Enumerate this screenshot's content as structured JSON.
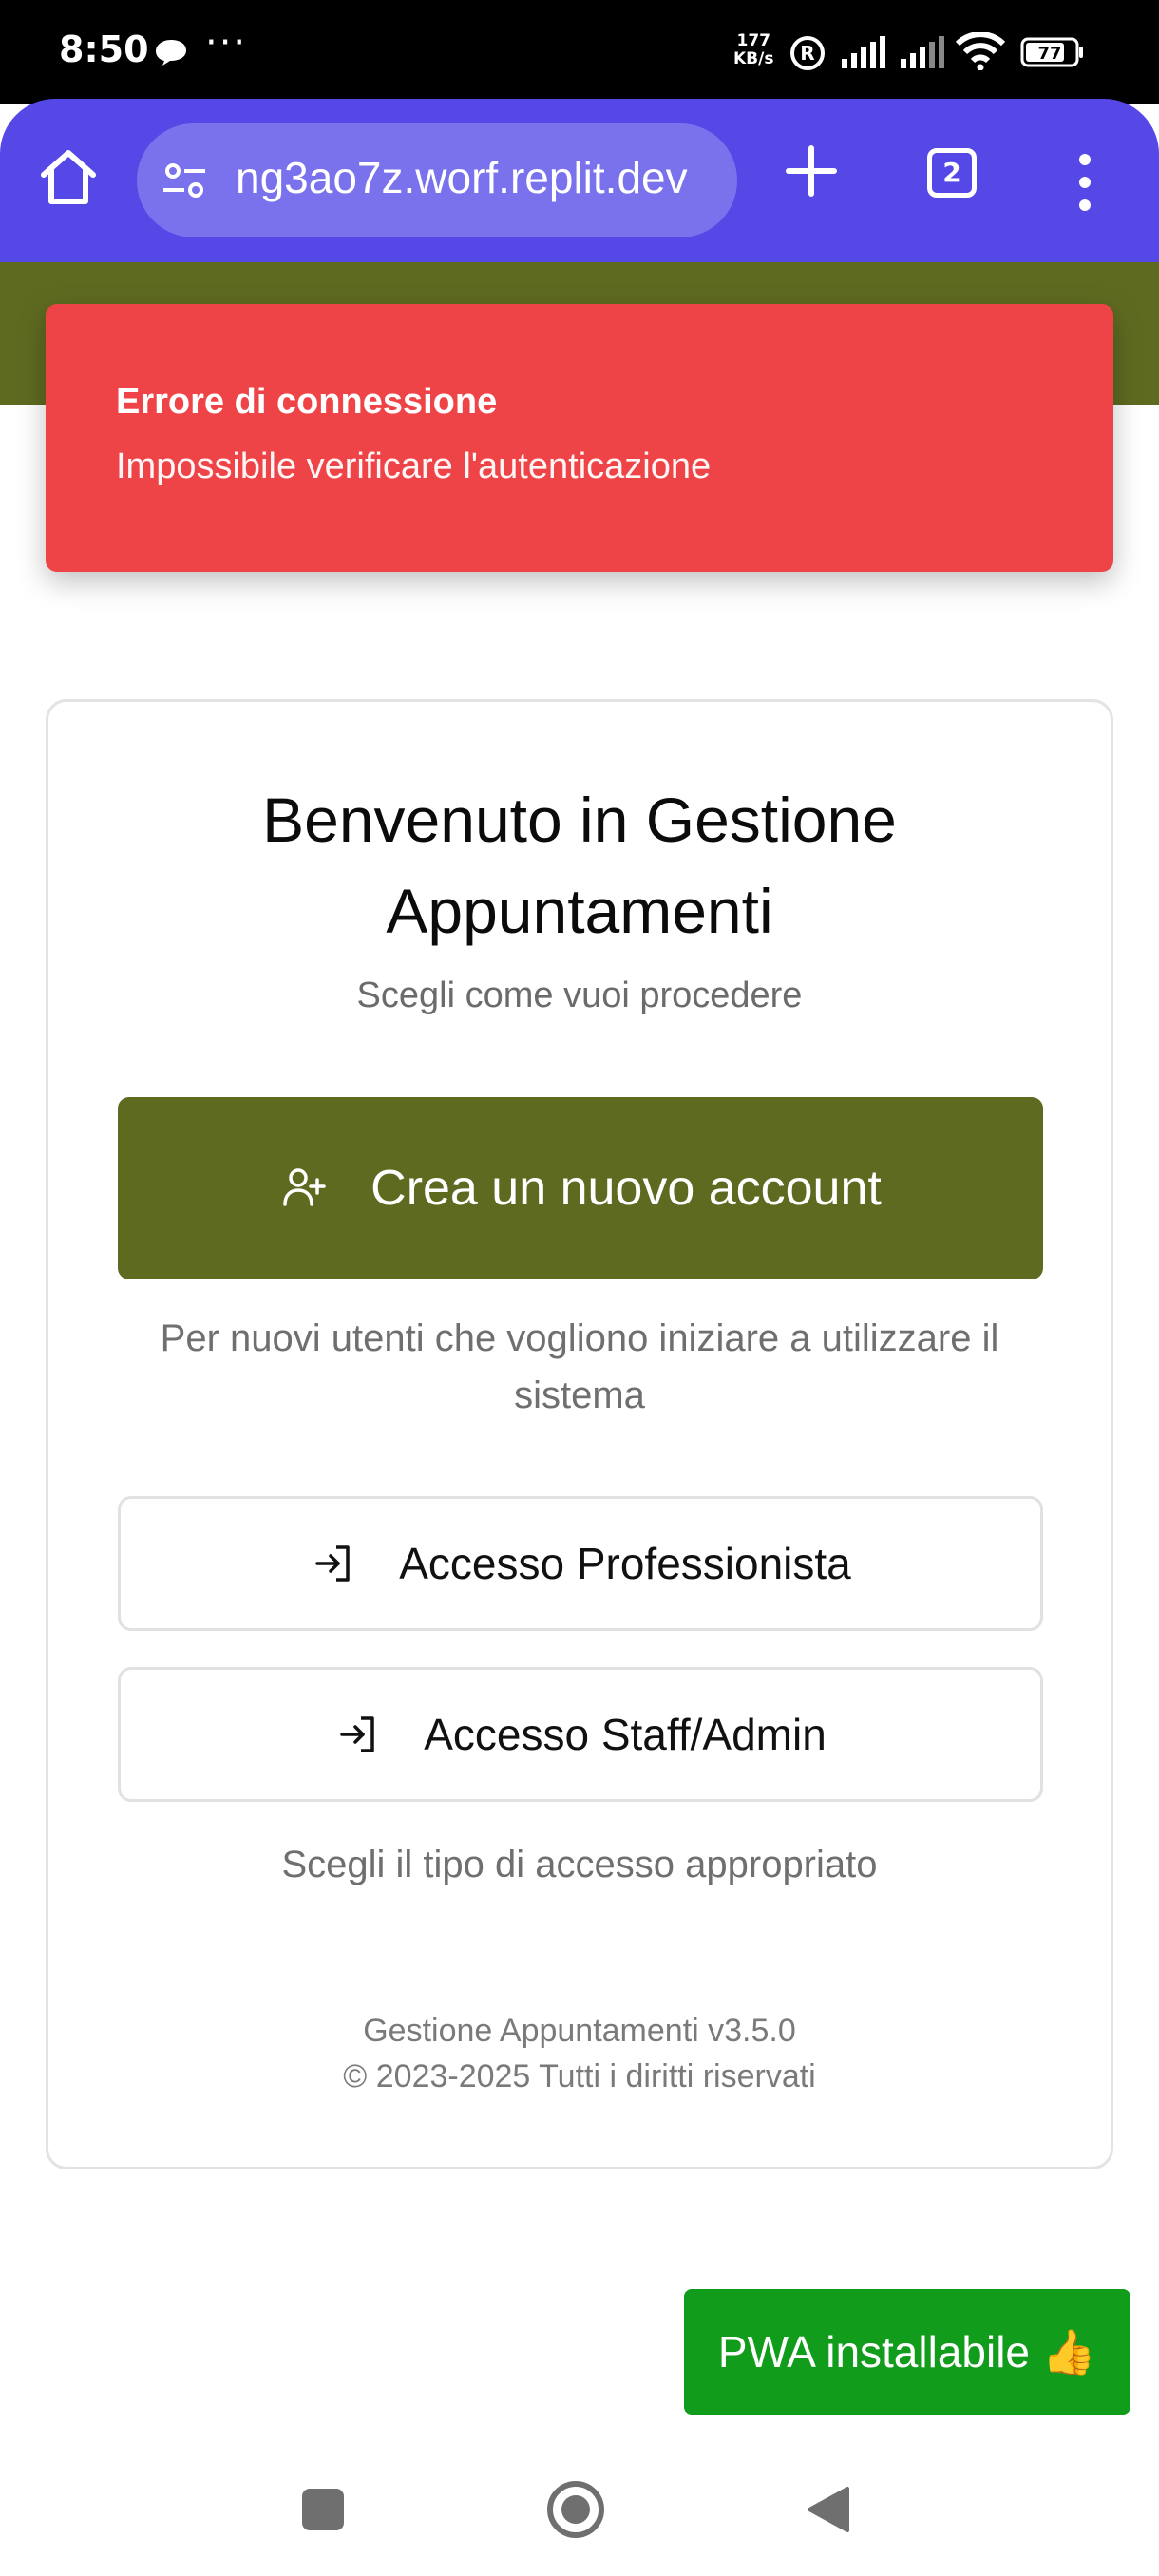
{
  "status_bar": {
    "time": "8:50",
    "more": "···",
    "net_speed_value": "177",
    "net_speed_unit": "KB/s",
    "r_badge": "R",
    "battery": "77"
  },
  "browser": {
    "url": "ng3ao7z.worf.replit.dev",
    "tab_count": "2",
    "accent_color": "#5548e6"
  },
  "toast": {
    "title": "Errore di connessione",
    "message": "Impossibile verificare l'autenticazione",
    "color": "#ef4447"
  },
  "card": {
    "title_line1": "Benvenuto in Gestione",
    "title_line2": "Appuntamenti",
    "subtitle": "Scegli come vuoi procedere",
    "primary_button": {
      "label": "Crea un nuovo account",
      "icon": "user-plus-icon",
      "color": "#5f6a21"
    },
    "primary_hint": "Per nuovi utenti che vogliono iniziare a utilizzare il sistema",
    "login_professional": {
      "label": "Accesso Professionista",
      "icon": "login-icon"
    },
    "login_staff": {
      "label": "Accesso Staff/Admin",
      "icon": "login-icon"
    },
    "login_hint": "Scegli il tipo di accesso appropriato",
    "version": "Gestione Appuntamenti v3.5.0",
    "copyright": "© 2023-2025 Tutti i diritti riservati"
  },
  "pwa_badge": {
    "label": "PWA installabile 👍",
    "color": "#119c1c"
  }
}
